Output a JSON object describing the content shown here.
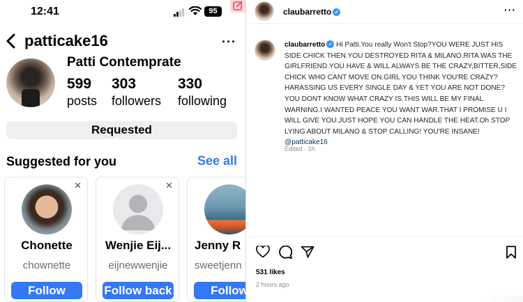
{
  "left_pane": {
    "status_bar": {
      "time": "12:41",
      "battery": "95"
    },
    "header": {
      "username": "patticake16"
    },
    "profile": {
      "display_name": "Patti Contemprate",
      "stats": [
        {
          "num": "599",
          "label": "posts"
        },
        {
          "num": "303",
          "label": "followers"
        },
        {
          "num": "330",
          "label": "following"
        }
      ],
      "requested_label": "Requested"
    },
    "suggested": {
      "title": "Suggested for you",
      "see_all": "See all",
      "cards": [
        {
          "name": "Chonette",
          "handle": "chownette",
          "button": "Follow"
        },
        {
          "name": "Wenjie Eij...",
          "handle": "eijnewwenjie",
          "button": "Follow back"
        },
        {
          "name": "Jenny R",
          "handle": "sweetjenn",
          "button": "Follow"
        }
      ]
    }
  },
  "right_pane": {
    "header": {
      "username": "claubarretto"
    },
    "caption": {
      "username": "claubarretto",
      "text": "Hi Patti.You really Won't Stop?YOU WERE JUST HIS SIDE CHICK THEN.YOU DESTROYED RITA & MILANO.RITA WAS THE GIRLFRIEND.YOU HAVE & WILL ALWAYS BE THE CRAZY,BITTER,SIDE CHICK WHO CANT MOVE ON.GIRL YOU THINK YOU'RE CRAZY? HARASSING US EVERY SINGLE DAY & YET YOU ARE NOT DONE? YOU DONT KNOW WHAT CRAZY IS.THIS WILL BE MY FINAL WARNING.I WANTED PEACE YOU WANT WAR.THAT I PROMISE U I WILL GIVE YOU.JUST HOPE YOU CAN HANDLE THE HEAT.Oh STOP LYING ABOUT MILANO & STOP CALLING! YOU'RE INSANE!",
      "mention": "@patticake16",
      "edited": "Edited · 1h"
    },
    "likes": "531 likes",
    "time_ago": "2 hours ago"
  },
  "colors": {
    "ios_blue": "#3478f6",
    "ig_verified": "#3897f0",
    "ig_mention": "#00376b",
    "muted": "#8e8e8e"
  },
  "icons": [
    "back-icon",
    "more-icon",
    "wifi-icon",
    "battery-icon",
    "close-icon",
    "verified-icon",
    "heart-icon",
    "comment-icon",
    "share-icon",
    "bookmark-icon"
  ]
}
